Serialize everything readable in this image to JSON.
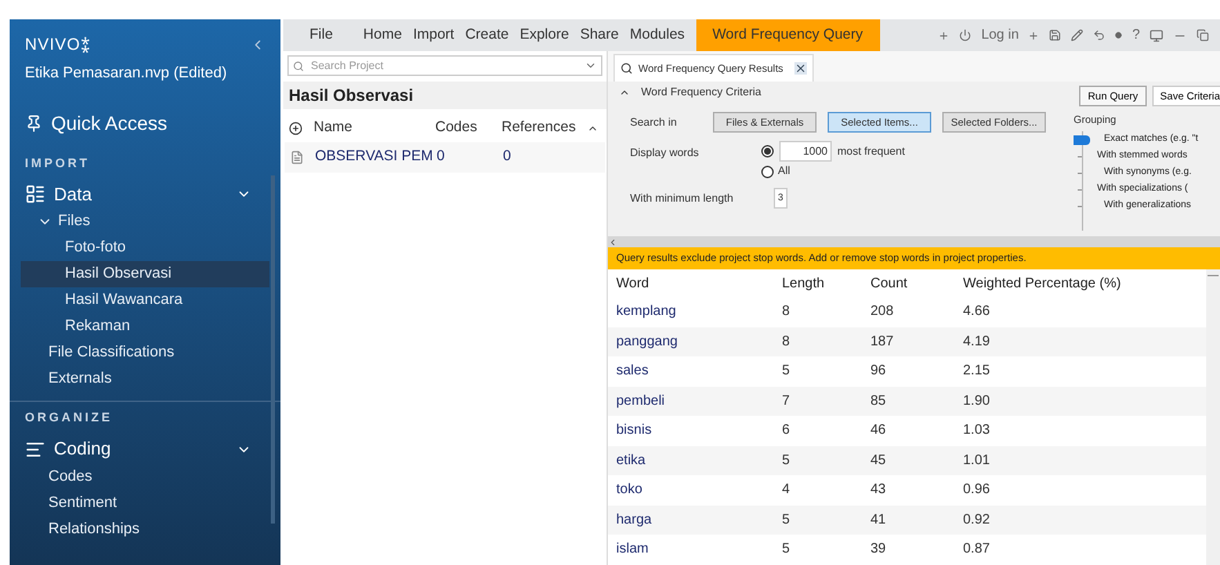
{
  "app": {
    "logo": "NVIVO⁑",
    "project": "Etika Pemasaran.nvp (Edited)"
  },
  "sidebar": {
    "quick_access": "Quick Access",
    "sections": [
      {
        "heading": "IMPORT",
        "group": "Data",
        "kind": "data",
        "expanded": true,
        "items": [
          {
            "label": "Files",
            "expanded": true,
            "selected": false,
            "children": [
              {
                "label": "Foto-foto",
                "selected": false
              },
              {
                "label": "Hasil Observasi",
                "selected": true
              },
              {
                "label": "Hasil Wawancara",
                "selected": false
              },
              {
                "label": "Rekaman",
                "selected": false
              }
            ]
          },
          {
            "label": "File Classifications",
            "selected": false
          },
          {
            "label": "Externals",
            "selected": false
          }
        ]
      },
      {
        "heading": "ORGANIZE",
        "group": "Coding",
        "kind": "coding",
        "expanded": true,
        "items": [
          {
            "label": "Codes",
            "selected": false
          },
          {
            "label": "Sentiment",
            "selected": false
          },
          {
            "label": "Relationships",
            "selected": false
          }
        ]
      }
    ]
  },
  "ribbon": {
    "tabs": [
      {
        "label": "File",
        "selected": false
      },
      {
        "label": "Home",
        "selected": false
      },
      {
        "label": "Import",
        "selected": false
      },
      {
        "label": "Create",
        "selected": false
      },
      {
        "label": "Explore",
        "selected": false
      },
      {
        "label": "Share",
        "selected": false
      },
      {
        "label": "Modules",
        "selected": false
      },
      {
        "label": "Word Frequency Query",
        "selected": true
      }
    ],
    "login": "Log in",
    "help": "?"
  },
  "list_view": {
    "search": {
      "placeholder": "Search Project"
    },
    "title": "Hasil Observasi",
    "columns": [
      "Name",
      "Codes",
      "References"
    ],
    "rows": [
      {
        "name": "OBSERVASI PEM",
        "codes": "0",
        "references": "0"
      }
    ]
  },
  "query": {
    "tab": {
      "label": "Word Frequency Query Results"
    },
    "criteria_title": "Word Frequency Criteria",
    "search_in_label": "Search in",
    "search_in": [
      {
        "label": "Files & Externals",
        "selected": false
      },
      {
        "label": "Selected Items...",
        "selected": true
      },
      {
        "label": "Selected Folders...",
        "selected": false
      }
    ],
    "display_label": "Display words",
    "display_options": [
      {
        "kind": "count",
        "selected": true,
        "value": "1000",
        "suffix": "most frequent"
      },
      {
        "kind": "all",
        "selected": false,
        "label": "All"
      }
    ],
    "min_length_label": "With minimum length",
    "min_length": "3",
    "run": "Run Query",
    "save": "Save Criteria",
    "grouping": {
      "label": "Grouping",
      "options": [
        {
          "label": "Exact matches (e.g. \"t",
          "selected": true
        },
        {
          "label": "With stemmed words",
          "selected": false
        },
        {
          "label": "With synonyms (e.g.",
          "selected": false
        },
        {
          "label": "With specializations (",
          "selected": false
        },
        {
          "label": "With generalizations",
          "selected": false
        }
      ]
    },
    "banner": "Query results exclude project stop words. Add or remove stop words in project properties.",
    "columns": [
      "Word",
      "Length",
      "Count",
      "Weighted Percentage (%)"
    ],
    "rows": [
      [
        "kemplang",
        "8",
        "208",
        "4.66"
      ],
      [
        "panggang",
        "8",
        "187",
        "4.19"
      ],
      [
        "sales",
        "5",
        "96",
        "2.15"
      ],
      [
        "pembeli",
        "7",
        "85",
        "1.90"
      ],
      [
        "bisnis",
        "6",
        "46",
        "1.03"
      ],
      [
        "etika",
        "5",
        "45",
        "1.01"
      ],
      [
        "toko",
        "4",
        "43",
        "0.96"
      ],
      [
        "harga",
        "5",
        "41",
        "0.92"
      ],
      [
        "islam",
        "5",
        "39",
        "0.87"
      ]
    ]
  }
}
